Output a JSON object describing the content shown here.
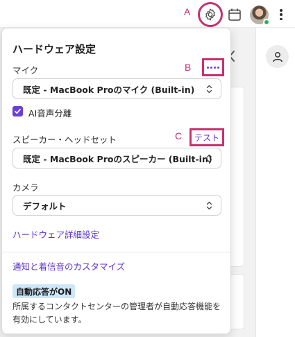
{
  "callouts": {
    "a": "A",
    "b": "B",
    "c": "C"
  },
  "panel": {
    "title": "ハードウェア設定",
    "mic": {
      "label": "マイク",
      "selected": "既定 - MacBook Proのマイク (Built-in)"
    },
    "noise_separation": {
      "label": "AI音声分離",
      "checked": true
    },
    "speaker": {
      "label": "スピーカー・ヘッドセット",
      "test_label": "テスト",
      "selected": "既定 - MacBook Proのスピーカー (Built-in)"
    },
    "camera": {
      "label": "カメラ",
      "selected": "デフォルト"
    },
    "advanced_link": "ハードウェア詳細設定",
    "notifications_link": "通知と着信音のカスタマイズ",
    "auto_answer": {
      "badge": "自動応答がON",
      "description": "所属するコンタクトセンターの管理者が自動応答機能を有効にしています。"
    }
  },
  "icons": {
    "settings": "gear-icon",
    "calendar": "calendar-icon",
    "more": "kebab-icon",
    "profile": "person-icon"
  },
  "colors": {
    "accent": "#6a3fd8",
    "link": "#5a32c8",
    "callout": "#c8306e",
    "badge_bg": "#cde7f7",
    "status_online": "#2db155"
  }
}
